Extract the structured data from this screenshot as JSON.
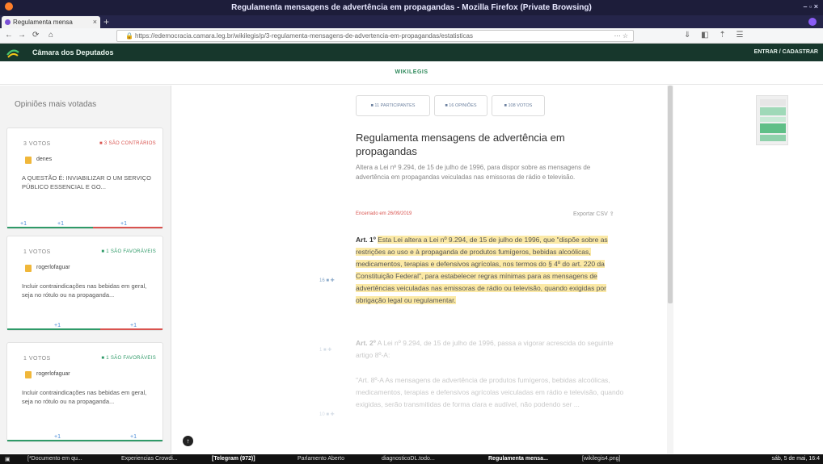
{
  "window": {
    "title": "Regulamenta mensagens de advertência em propagandas - Mozilla Firefox (Private Browsing)",
    "controls": "– ▫ ×"
  },
  "browser": {
    "tab_title": "Regulamenta mensa",
    "tab_close": "×",
    "new_tab": "+",
    "back": "←",
    "forward": "→",
    "reload": "⟳",
    "home": "⌂",
    "url": "https://edemocracia.camara.leg.br/wikilegis/p/3-regulamenta-mensagens-de-advertencia-em-propagandas/estatisticas",
    "url_actions": "⋯ ☆",
    "toolbar_icons": "⇓ ◧ ⇡ ☰"
  },
  "site": {
    "name": "Câmara dos Deputados",
    "login": "ENTRAR / CADASTRAR",
    "brand": "WIKILEGIS"
  },
  "sidebar": {
    "title": "Opiniões mais votadas",
    "cards": [
      {
        "votes": "3 VOTOS",
        "stance": "■ 3 SÃO CONTRÁRIOS",
        "stance_type": "against",
        "user": "denes",
        "body": "A QUESTÃO É: INVIABILIZAR O UM SERVIÇO PÚBLICO ESSENCIAL E GO...",
        "reply": "+1",
        "a1": "+1",
        "a2": "+1",
        "bar": [
          0.55,
          0.45
        ],
        "bar_colors": [
          "#2f9a68",
          "#d9534f"
        ]
      },
      {
        "votes": "1 VOTOS",
        "stance": "■ 1 SÃO FAVORÁVEIS",
        "stance_type": "favor",
        "user": "rogerlofaguar",
        "body": "Incluir contraindicações nas bebidas em geral, seja no rótulo ou na propaganda...",
        "a1": "+1",
        "a2": "+1",
        "bar": [
          0.6,
          0.4
        ],
        "bar_colors": [
          "#2f9a68",
          "#d9534f"
        ]
      },
      {
        "votes": "1 VOTOS",
        "stance": "■ 1 SÃO FAVORÁVEIS",
        "stance_type": "favor",
        "user": "rogerlofaguar",
        "body": "Incluir contraindicações nas bebidas em geral, seja no rótulo ou na propaganda...",
        "a1": "+1",
        "a2": "+1",
        "bar": [
          1.0,
          0
        ],
        "bar_colors": [
          "#2f9a68",
          "#d9534f"
        ]
      }
    ]
  },
  "chips": [
    {
      "label": "■ 11 PARTICIPANTES"
    },
    {
      "label": "■ 16 OPINIÕES"
    },
    {
      "label": "■ 108 VOTOS"
    }
  ],
  "law": {
    "title": "Regulamenta mensagens de advertência em propagandas",
    "summary": "Altera a Lei nº 9.294, de 15 de julho de 1996, para dispor sobre as mensagens de advertência em propagandas veiculadas nas emissoras de rádio e televisão.",
    "date": "Encerrado em 26/09/2019",
    "share": "Exportar CSV"
  },
  "articles": [
    {
      "count": "16 ■ ✚",
      "label": "Art. 1º",
      "text": "Esta Lei altera a Lei nº 9.294, de 15 de julho de 1996, que \"dispõe sobre as restrições ao uso e à propaganda de produtos fumígeros, bebidas alcoólicas, medicamentos, terapias e defensivos agrícolas, nos termos do § 4º do art. 220 da Constituição Federal\", para estabelecer regras mínimas para as mensagens de advertências veiculadas nas emissoras de rádio ou televisão, quando exigidas por obrigação legal ou regulamentar."
    },
    {
      "count": "1 ■ ✚",
      "label": "Art. 2º",
      "text": "A Lei nº 9.294, de 15 de julho de 1996, passa a vigorar acrescida do seguinte artigo 8º-A:"
    },
    {
      "count": "10 ■ ✚",
      "label": "",
      "text": "\"Art. 8º-A As mensagens de advertência de produtos fumígeros, bebidas alcoólicas, medicamentos, terapias e defensivos agrícolas veiculadas em rádio e televisão, quando exigidas, serão transmitidas de forma clara e audível, não podendo ser ..."
    }
  ],
  "taskbar": {
    "items": [
      "[*Documento em qu...",
      "Experiencias Crowdi...",
      "[Telegram (972)]",
      "Parlamento Aberto",
      "diagnosticoDL.todo...",
      "Regulamenta mensa...",
      "[wikilegis4.png]"
    ],
    "clock": "sáb, 5 de mai, 16:4"
  }
}
